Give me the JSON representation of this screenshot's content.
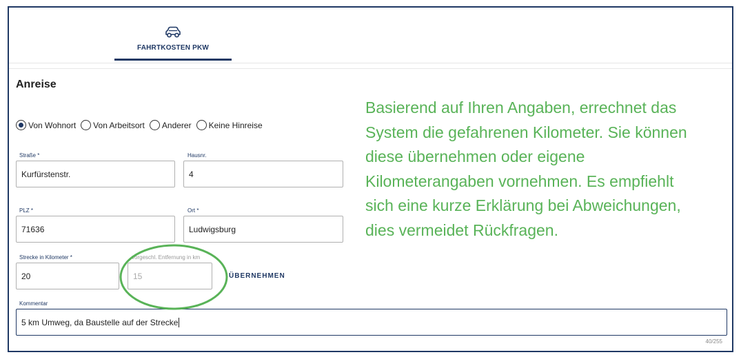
{
  "tabs": [
    {
      "label": "FAHRTKOSTEN PKW",
      "icon": "car-icon",
      "active": true
    }
  ],
  "section": {
    "title": "Anreise"
  },
  "radio": {
    "options": [
      "Von Wohnort",
      "Von Arbeitsort",
      "Anderer",
      "Keine Hinreise"
    ],
    "selected": "Von Wohnort"
  },
  "form": {
    "street": {
      "label": "Straße *",
      "value": "Kurfürstenstr."
    },
    "house_number": {
      "label": "Hausnr.",
      "value": "4"
    },
    "zip": {
      "label": "PLZ *",
      "value": "71636"
    },
    "city": {
      "label": "Ort *",
      "value": "Ludwigsburg"
    },
    "distance": {
      "label": "Strecke in Kilometer *",
      "value": "20"
    },
    "suggested": {
      "label": "vorgeschl. Entfernung in km",
      "value": "15"
    },
    "apply_label": "ÜBERNEHMEN",
    "comment": {
      "label": "Kommentar",
      "value": "5 km Umweg, da Baustelle auf der Strecke"
    },
    "counter": "40/255"
  },
  "annotation": {
    "text": "Basierend auf Ihren Angaben, errechnet das System die gefahrenen Kilometer. Sie können diese übernehmen oder eigene Kilometerangaben vornehmen. Es empfiehlt sich eine kurze Erklärung bei Abweichungen, dies vermeidet Rückfragen.",
    "color": "#59b358"
  },
  "colors": {
    "accent": "#1f3864",
    "annotation": "#59b358"
  }
}
